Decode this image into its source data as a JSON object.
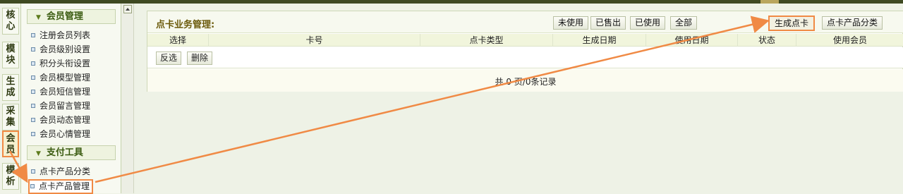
{
  "vertical_tabs": [
    {
      "label": "核心"
    },
    {
      "label": "模块"
    },
    {
      "label": "生成"
    },
    {
      "label": "采集"
    },
    {
      "label": "会员",
      "active": true
    },
    {
      "label": "模析"
    }
  ],
  "sidebar": {
    "groups": [
      {
        "title": "会员管理",
        "items": [
          {
            "label": "注册会员列表"
          },
          {
            "label": "会员级别设置"
          },
          {
            "label": "积分头衔设置"
          },
          {
            "label": "会员模型管理"
          },
          {
            "label": "会员短信管理"
          },
          {
            "label": "会员留言管理"
          },
          {
            "label": "会员动态管理"
          },
          {
            "label": "会员心情管理"
          }
        ]
      },
      {
        "title": "支付工具",
        "items": [
          {
            "label": "点卡产品分类"
          },
          {
            "label": "点卡产品管理",
            "highlighted": true
          }
        ]
      }
    ]
  },
  "panel": {
    "title": "点卡业务管理:",
    "filters": [
      "未使用",
      "已售出",
      "已使用",
      "全部"
    ],
    "actions": [
      "生成点卡",
      "点卡产品分类"
    ],
    "columns": [
      "选择",
      "卡号",
      "点卡类型",
      "生成日期",
      "使用日期",
      "状态",
      "使用会员"
    ],
    "row_actions": [
      "反选",
      "删除"
    ],
    "footer": "共 0 页/0条记录"
  },
  "colors": {
    "highlight": "#f08a45",
    "accent_text": "#6b5a0b"
  }
}
